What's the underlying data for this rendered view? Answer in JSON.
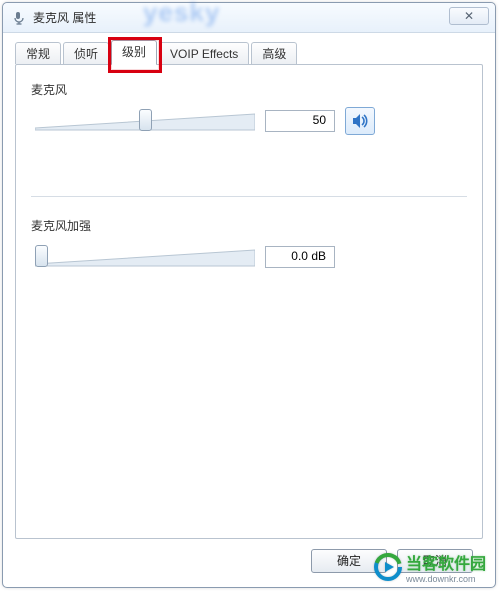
{
  "window": {
    "title": "麦克风 属性",
    "close_symbol": "✕"
  },
  "tabs": [
    {
      "label": "常规"
    },
    {
      "label": "侦听"
    },
    {
      "label": "级别"
    },
    {
      "label": "VOIP Effects"
    },
    {
      "label": "高级"
    }
  ],
  "active_tab_index": 2,
  "mic": {
    "label": "麦克风",
    "value": "50",
    "slider_percent": 50
  },
  "boost": {
    "label": "麦克风加强",
    "value": "0.0 dB",
    "slider_percent": 0
  },
  "buttons": {
    "ok": "确定",
    "cancel": "取消"
  },
  "watermark": {
    "top": "yesky",
    "bottom_main": "当客软件园",
    "bottom_sub": "www.downkr.com"
  }
}
